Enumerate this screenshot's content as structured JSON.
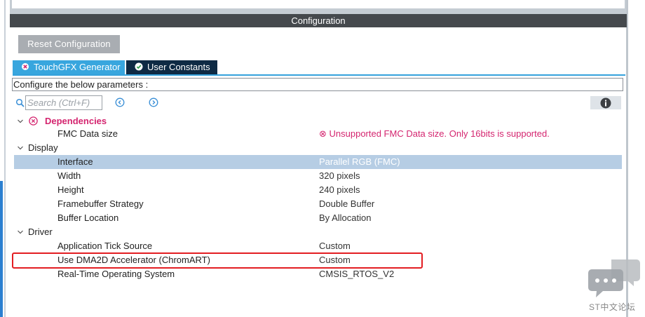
{
  "panel": {
    "title": "Configuration"
  },
  "toolbar": {
    "reset_label": "Reset Configuration"
  },
  "tabs": [
    {
      "label": "TouchGFX Generator",
      "icon": "error-circle-icon",
      "active": true
    },
    {
      "label": "User Constants",
      "icon": "check-circle-icon",
      "active": false
    }
  ],
  "params_caption": "Configure the below parameters :",
  "search": {
    "placeholder": "Search (Ctrl+F)"
  },
  "tree": {
    "dependencies": {
      "label": "Dependencies",
      "items": [
        {
          "name": "FMC Data size",
          "value": "⊗ Unsupported FMC Data size. Only 16bits is supported."
        }
      ]
    },
    "display": {
      "label": "Display",
      "items": [
        {
          "name": "Interface",
          "value": "Parallel RGB (FMC)"
        },
        {
          "name": "Width",
          "value": "320 pixels"
        },
        {
          "name": "Height",
          "value": "240 pixels"
        },
        {
          "name": "Framebuffer Strategy",
          "value": "Double Buffer"
        },
        {
          "name": "Buffer Location",
          "value": "By Allocation"
        }
      ]
    },
    "driver": {
      "label": "Driver",
      "items": [
        {
          "name": "Application Tick Source",
          "value": "Custom"
        },
        {
          "name": "Use DMA2D Accelerator (ChromART)",
          "value": "Custom"
        },
        {
          "name": "Real-Time Operating System",
          "value": "CMSIS_RTOS_V2"
        }
      ]
    }
  },
  "watermark": {
    "text": "ST中文论坛"
  },
  "colors": {
    "header_bg": "#45494d",
    "tab_active": "#38a6de",
    "tab_inactive": "#0e2a44",
    "error": "#d4256f",
    "selection": "#b6cde4",
    "highlight": "#e31d22"
  }
}
